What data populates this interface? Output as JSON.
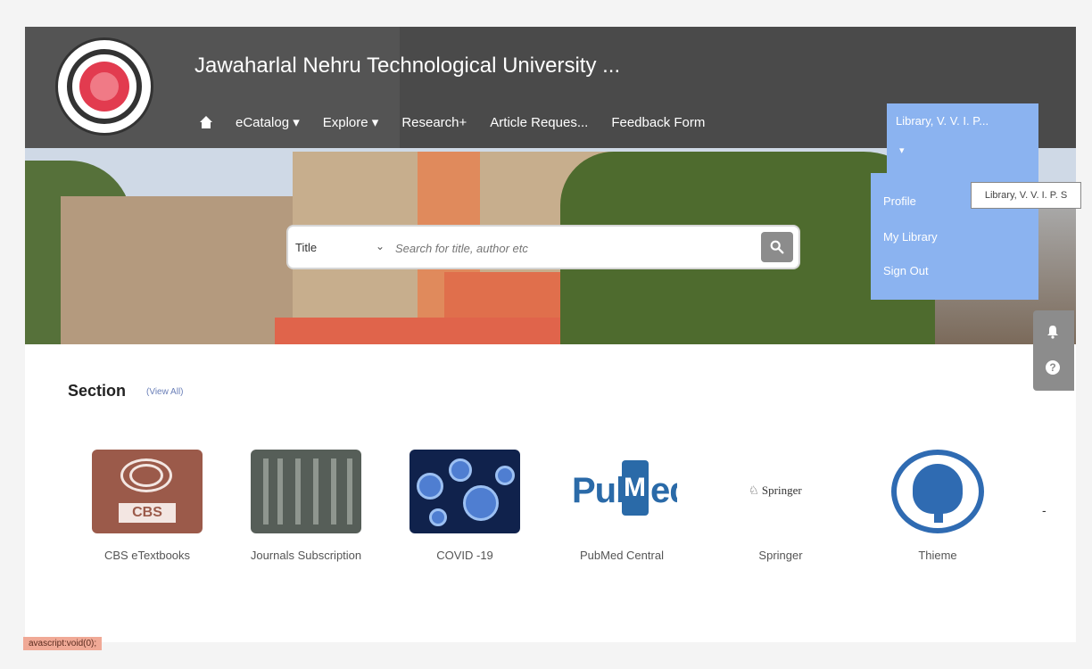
{
  "header": {
    "title": "Jawaharlal Nehru Technological University ...",
    "logo_name": "jntu-anantapur-logo"
  },
  "nav": {
    "home_icon": "home-icon",
    "items": [
      "eCatalog ▾",
      "Explore ▾",
      "Research+",
      "Article Reques...",
      "Feedback Form"
    ]
  },
  "search": {
    "field_select": "Title",
    "placeholder": "Search for title, author etc",
    "button_icon": "search-icon"
  },
  "account": {
    "label": "Library, V. V. I. P...",
    "menu": [
      "Profile",
      "My Library",
      "Sign Out"
    ],
    "tooltip": "Library, V. V. I. P. S"
  },
  "side_buttons": {
    "notify_icon": "bell-icon",
    "help_icon": "help-icon",
    "help_glyph": "?"
  },
  "section": {
    "title": "Section",
    "view_all": "(View All)"
  },
  "cards": [
    {
      "label": "CBS eTextbooks",
      "logo_text": "CBS"
    },
    {
      "label": "Journals Subscription"
    },
    {
      "label": "COVID -19"
    },
    {
      "label": "PubMed Central",
      "logo_text_a": "Pub",
      "logo_text_b": "M",
      "logo_text_c": "ed"
    },
    {
      "label": "Springer",
      "logo_text": "Springer"
    },
    {
      "label": "Thieme"
    }
  ],
  "status_bar": {
    "text": "avascript:void(0);"
  },
  "colors": {
    "menu_blue": "#8bb3f0",
    "header_gray": "#545454",
    "search_button": "#8c8c8c"
  }
}
